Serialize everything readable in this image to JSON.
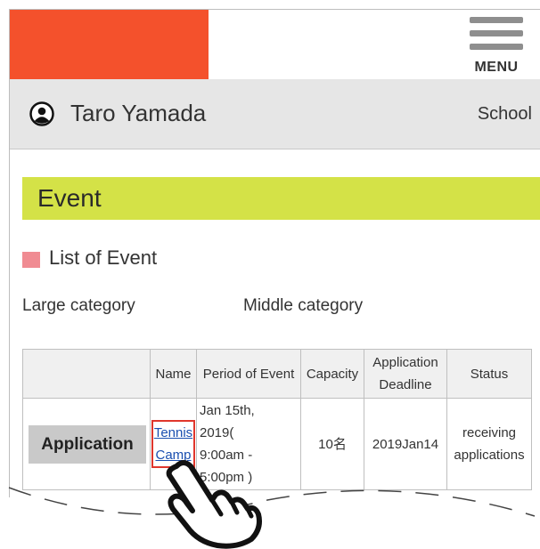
{
  "header": {
    "menu_label": "MENU"
  },
  "user_bar": {
    "user_name": "Taro Yamada",
    "school_label": "School"
  },
  "section": {
    "title": "Event"
  },
  "list": {
    "title": "List of Event",
    "large_category_label": "Large category",
    "middle_category_label": "Middle category"
  },
  "table": {
    "headers": [
      "",
      "Name",
      "Period of Event",
      "Capacity",
      "Application Deadline",
      "Status"
    ],
    "rows": [
      {
        "action_label": "Application",
        "name_line1": "Tennis",
        "name_line2": "Camp",
        "period_line1": "Jan 15th,",
        "period_line2": "2019(",
        "period_line3": "9:00am -",
        "period_line4": "5:00pm )",
        "capacity": "10名",
        "deadline": "2019Jan14",
        "status": "receiving applications"
      }
    ]
  },
  "colors": {
    "brand": "#f4512c",
    "event_bar": "#d4e247",
    "list_marker": "#f08b92",
    "highlight": "#e0362c",
    "link": "#1a4fb0"
  },
  "icons": [
    "user-circle-icon",
    "hamburger-menu-icon",
    "pointing-hand-icon"
  ]
}
